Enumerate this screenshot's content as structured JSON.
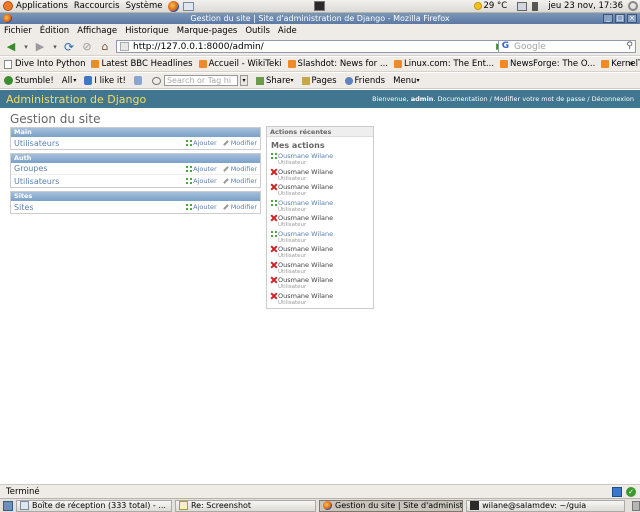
{
  "top_panel": {
    "applications": "Applications",
    "shortcuts": "Raccourcis",
    "system": "Système",
    "weather": "29 °C",
    "clock": "jeu 23 nov, 17:36"
  },
  "window": {
    "title": "Gestion du site | Site d'administration de Django - Mozilla Firefox",
    "buttons": [
      "_",
      "□",
      "×"
    ]
  },
  "menubar": {
    "items": [
      "Fichier",
      "Édition",
      "Affichage",
      "Historique",
      "Marque-pages",
      "Outils",
      "Aide"
    ]
  },
  "navbar": {
    "url": "http://127.0.0.1:8000/admin/",
    "search_placeholder": "Google"
  },
  "bookmarks": {
    "items": [
      {
        "label": "Dive Into Python",
        "icon": "page-icon"
      },
      {
        "label": "Latest BBC Headlines",
        "icon": "rss-icon"
      },
      {
        "label": "Accueil - WikiTeki",
        "icon": "rss-icon"
      },
      {
        "label": "Slashdot: News for ...",
        "icon": "rss-icon"
      },
      {
        "label": "Linux.com: The Ent...",
        "icon": "rss-icon"
      },
      {
        "label": "NewsForge: The O...",
        "icon": "rss-icon"
      },
      {
        "label": "KernelTrap",
        "icon": "rss-icon"
      }
    ],
    "more": "»"
  },
  "stumble_toolbar": {
    "stumble": "Stumble!",
    "all": "All",
    "ilike": "I like it!",
    "tag_placeholder": "Search or Tag hi",
    "share": "Share",
    "pages": "Pages",
    "friends": "Friends",
    "menu": "Menu"
  },
  "django": {
    "brand": "Administration de Django",
    "welcome": "Bienvenue,",
    "username": "admin",
    "user_links": ". Documentation / Modifier votre mot de passe / Déconnexion",
    "page_title": "Gestion du site",
    "add_label": "Ajouter",
    "change_label": "Modifier",
    "modules": [
      {
        "caption": "Main",
        "models": [
          "Utilisateurs"
        ]
      },
      {
        "caption": "Auth",
        "models": [
          "Groupes",
          "Utilisateurs"
        ]
      },
      {
        "caption": "Sites",
        "models": [
          "Sites"
        ]
      }
    ],
    "recent": {
      "caption": "Actions récentes",
      "subtitle": "Mes actions",
      "items": [
        {
          "name": "Ousmane Wilane",
          "type": "Utilisateur",
          "action": "add"
        },
        {
          "name": "Ousmane Wilane",
          "type": "Utilisateur",
          "action": "delete"
        },
        {
          "name": "Ousmane Wilane",
          "type": "Utilisateur",
          "action": "delete"
        },
        {
          "name": "Ousmane Wilane",
          "type": "Utilisateur",
          "action": "add"
        },
        {
          "name": "Ousmane Wilane",
          "type": "Utilisateur",
          "action": "delete"
        },
        {
          "name": "Ousmane Wilane",
          "type": "Utilisateur",
          "action": "add"
        },
        {
          "name": "Ousmane Wilane",
          "type": "Utilisateur",
          "action": "delete"
        },
        {
          "name": "Ousmane Wilane",
          "type": "Utilisateur",
          "action": "delete"
        },
        {
          "name": "Ousmane Wilane",
          "type": "Utilisateur",
          "action": "delete"
        },
        {
          "name": "Ousmane Wilane",
          "type": "Utilisateur",
          "action": "delete"
        }
      ]
    }
  },
  "statusbar": {
    "text": "Terminé"
  },
  "taskbar": {
    "tasks": [
      {
        "label": "Boîte de réception (333 total) - ...",
        "icon": "ti-mail",
        "active": false
      },
      {
        "label": "Re: Screenshot",
        "icon": "ti-comp",
        "active": false
      },
      {
        "label": "Gestion du site | Site d'administr...",
        "icon": "ti-ff",
        "active": true
      },
      {
        "label": "wilane@salamdev: ~/guia",
        "icon": "ti-term",
        "active": false
      }
    ]
  },
  "colors": {
    "django_header": "#417690",
    "django_brand": "#f5dd5d",
    "module_caption": "#7ca0c7",
    "link": "#5b80b2"
  }
}
